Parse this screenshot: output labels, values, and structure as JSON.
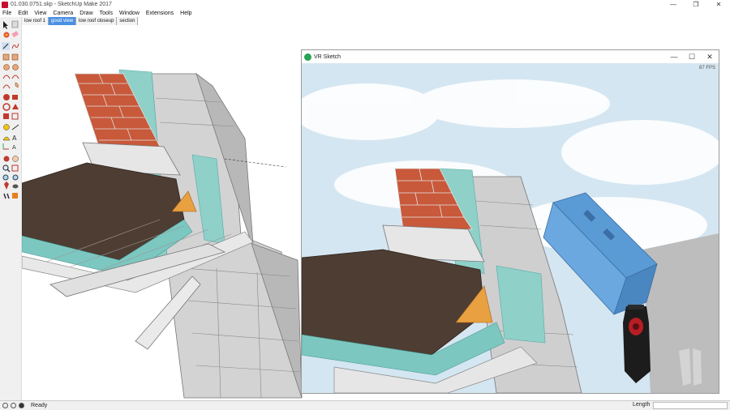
{
  "titlebar": {
    "title": "01.030.0751.skp - SketchUp Make 2017",
    "minimize": "—",
    "maximize": "❐",
    "close": "✕"
  },
  "menu": [
    "File",
    "Edit",
    "View",
    "Camera",
    "Draw",
    "Tools",
    "Window",
    "Extensions",
    "Help"
  ],
  "tabs": [
    {
      "label": "low roof 1",
      "active": false
    },
    {
      "label": "good view",
      "active": true
    },
    {
      "label": "low roof closeup",
      "active": false
    },
    {
      "label": "section",
      "active": false
    }
  ],
  "vr_window": {
    "title": "VR Sketch",
    "fps": "87 FPS",
    "minimize": "—",
    "maximize": "☐",
    "close": "✕"
  },
  "status": {
    "ready": "Ready",
    "length_label": "Length",
    "length_value": ""
  },
  "colors": {
    "brick": "#c8593b",
    "insulation": "#7cc7c0",
    "block": "#c9c9c9",
    "membrane": "#4e3d33",
    "wood": "#e8a040",
    "steel": "#dcdcdc",
    "vr_block": "#5b9bd5",
    "sky": "#cfe2ee"
  }
}
